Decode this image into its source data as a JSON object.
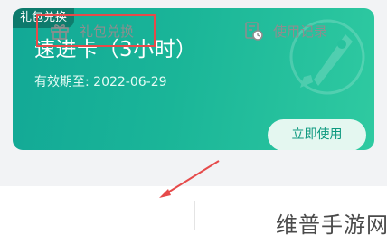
{
  "card": {
    "tag": "礼包兑换",
    "title": "速进卡（3小时）",
    "validity": "有效期至: 2022-06-29",
    "use_button": "立即使用",
    "accent": "#1ab598"
  },
  "tabs": {
    "exchange_label": "礼包兑换",
    "records_label": "使用记录"
  },
  "annotation": {
    "arrow_color": "#e64a4a",
    "highlight_color": "#e64a4a"
  },
  "watermark": {
    "text": "维普手游网"
  }
}
